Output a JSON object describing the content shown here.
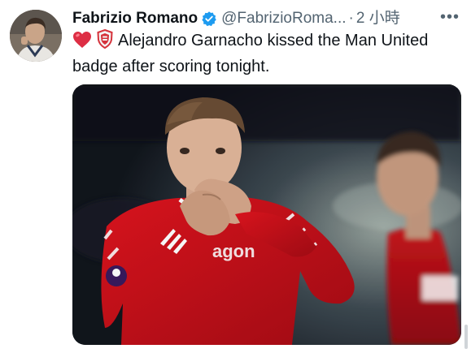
{
  "author": {
    "name": "Fabrizio Romano",
    "handle": "@FabrizioRoma...",
    "separator": "·",
    "time": "2 小時"
  },
  "tweet": {
    "text": "Alejandro Garnacho kissed the Man United badge after scoring tonight."
  },
  "icons": {
    "verified": "verified-badge-icon",
    "more": "more-options-icon",
    "heart": "red-heart-emoji",
    "badge": "shield-badge-emoji"
  },
  "colors": {
    "name": "#0f1419",
    "secondary": "#536471",
    "verified": "#1d9bf0",
    "kit_red": "#d0101a"
  }
}
